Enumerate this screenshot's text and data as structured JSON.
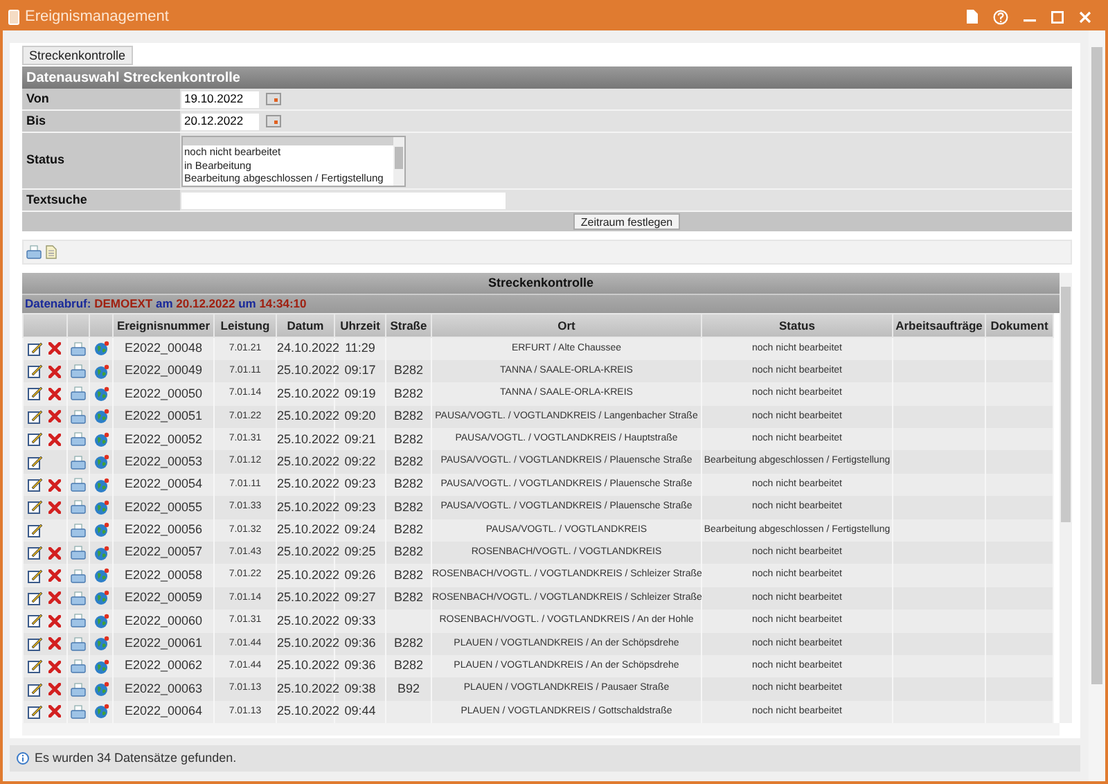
{
  "window": {
    "title": "Ereignismanagement"
  },
  "tabs": [
    {
      "label": "Streckenkontrolle",
      "selected": true
    }
  ],
  "form": {
    "title": "Datenauswahl Streckenkontrolle",
    "from": {
      "label": "Von",
      "value": "19.10.2022"
    },
    "to": {
      "label": "Bis",
      "value": "20.12.2022"
    },
    "status": {
      "label": "Status",
      "options": [
        "noch nicht bearbeitet",
        "in Bearbeitung",
        "Bearbeitung abgeschlossen / Fertigstellung"
      ]
    },
    "search": {
      "label": "Textsuche"
    },
    "submit": "Zeitraum festlegen"
  },
  "table": {
    "title": "Streckenkontrolle",
    "fetch": {
      "label": "Datenabruf:",
      "user": "DEMOEXT",
      "on": "am",
      "date": "20.12.2022",
      "at": "um",
      "time": "14:34:10"
    },
    "columns": [
      "Ereignisnummer",
      "Leistung",
      "Datum",
      "Uhrzeit",
      "Straße",
      "Ort",
      "Status",
      "Arbeitsaufträge",
      "Dokument"
    ],
    "rows": [
      {
        "deletable": true,
        "id": "E2022_00048",
        "service": "7.01.21",
        "date": "24.10.2022",
        "time": "11:29",
        "road": "",
        "place": "ERFURT / Alte Chaussee",
        "status": "noch nicht bearbeitet"
      },
      {
        "deletable": true,
        "id": "E2022_00049",
        "service": "7.01.11",
        "date": "25.10.2022",
        "time": "09:17",
        "road": "B282",
        "place": "TANNA / SAALE-ORLA-KREIS",
        "status": "noch nicht bearbeitet"
      },
      {
        "deletable": true,
        "id": "E2022_00050",
        "service": "7.01.14",
        "date": "25.10.2022",
        "time": "09:19",
        "road": "B282",
        "place": "TANNA / SAALE-ORLA-KREIS",
        "status": "noch nicht bearbeitet"
      },
      {
        "deletable": true,
        "id": "E2022_00051",
        "service": "7.01.22",
        "date": "25.10.2022",
        "time": "09:20",
        "road": "B282",
        "place": "PAUSA/VOGTL. / VOGTLANDKREIS / Langenbacher Straße",
        "status": "noch nicht bearbeitet"
      },
      {
        "deletable": true,
        "id": "E2022_00052",
        "service": "7.01.31",
        "date": "25.10.2022",
        "time": "09:21",
        "road": "B282",
        "place": "PAUSA/VOGTL. / VOGTLANDKREIS / Hauptstraße",
        "status": "noch nicht bearbeitet"
      },
      {
        "deletable": false,
        "id": "E2022_00053",
        "service": "7.01.12",
        "date": "25.10.2022",
        "time": "09:22",
        "road": "B282",
        "place": "PAUSA/VOGTL. / VOGTLANDKREIS / Plauensche Straße",
        "status": "Bearbeitung abgeschlossen / Fertigstellung"
      },
      {
        "deletable": true,
        "id": "E2022_00054",
        "service": "7.01.11",
        "date": "25.10.2022",
        "time": "09:23",
        "road": "B282",
        "place": "PAUSA/VOGTL. / VOGTLANDKREIS / Plauensche Straße",
        "status": "noch nicht bearbeitet"
      },
      {
        "deletable": true,
        "id": "E2022_00055",
        "service": "7.01.33",
        "date": "25.10.2022",
        "time": "09:23",
        "road": "B282",
        "place": "PAUSA/VOGTL. / VOGTLANDKREIS / Plauensche Straße",
        "status": "noch nicht bearbeitet"
      },
      {
        "deletable": false,
        "id": "E2022_00056",
        "service": "7.01.32",
        "date": "25.10.2022",
        "time": "09:24",
        "road": "B282",
        "place": "PAUSA/VOGTL. / VOGTLANDKREIS",
        "status": "Bearbeitung abgeschlossen / Fertigstellung"
      },
      {
        "deletable": true,
        "id": "E2022_00057",
        "service": "7.01.43",
        "date": "25.10.2022",
        "time": "09:25",
        "road": "B282",
        "place": "ROSENBACH/VOGTL. / VOGTLANDKREIS",
        "status": "noch nicht bearbeitet"
      },
      {
        "deletable": true,
        "id": "E2022_00058",
        "service": "7.01.22",
        "date": "25.10.2022",
        "time": "09:26",
        "road": "B282",
        "place": "ROSENBACH/VOGTL. / VOGTLANDKREIS / Schleizer Straße",
        "status": "noch nicht bearbeitet"
      },
      {
        "deletable": true,
        "id": "E2022_00059",
        "service": "7.01.14",
        "date": "25.10.2022",
        "time": "09:27",
        "road": "B282",
        "place": "ROSENBACH/VOGTL. / VOGTLANDKREIS / Schleizer Straße",
        "status": "noch nicht bearbeitet"
      },
      {
        "deletable": true,
        "id": "E2022_00060",
        "service": "7.01.31",
        "date": "25.10.2022",
        "time": "09:33",
        "road": "",
        "place": "ROSENBACH/VOGTL. / VOGTLANDKREIS / An der Hohle",
        "status": "noch nicht bearbeitet"
      },
      {
        "deletable": true,
        "id": "E2022_00061",
        "service": "7.01.44",
        "date": "25.10.2022",
        "time": "09:36",
        "road": "B282",
        "place": "PLAUEN / VOGTLANDKREIS / An der Schöpsdrehe",
        "status": "noch nicht bearbeitet"
      },
      {
        "deletable": true,
        "id": "E2022_00062",
        "service": "7.01.44",
        "date": "25.10.2022",
        "time": "09:36",
        "road": "B282",
        "place": "PLAUEN / VOGTLANDKREIS / An der Schöpsdrehe",
        "status": "noch nicht bearbeitet"
      },
      {
        "deletable": true,
        "id": "E2022_00063",
        "service": "7.01.13",
        "date": "25.10.2022",
        "time": "09:38",
        "road": "B92",
        "place": "PLAUEN / VOGTLANDKREIS / Pausaer Straße",
        "status": "noch nicht bearbeitet"
      },
      {
        "deletable": true,
        "id": "E2022_00064",
        "service": "7.01.13",
        "date": "25.10.2022",
        "time": "09:44",
        "road": "",
        "place": "PLAUEN / VOGTLANDKREIS / Gottschaldstraße",
        "status": "noch nicht bearbeitet"
      }
    ]
  },
  "footer": "Es wurden 34 Datensätze gefunden."
}
